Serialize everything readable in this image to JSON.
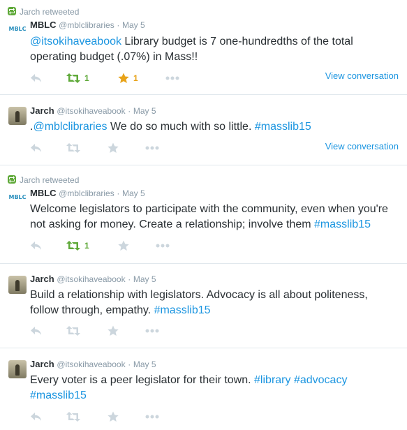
{
  "tweets": [
    {
      "retweeted_by": "Jarch retweeted",
      "name": "MBLC",
      "handle": "@mblclibraries",
      "dot": "·",
      "date": "May 5",
      "avatar_text": "MBLC",
      "body_parts": [
        {
          "text": "@itsokihaveabook",
          "link": true
        },
        {
          "text": " Library budget is 7 one-hundredths of the total operating budget (.07%) in Mass!!",
          "link": false
        }
      ],
      "retweet_count": "1",
      "favorite_count": "1",
      "view_conversation": "View conversation"
    },
    {
      "name": "Jarch",
      "handle": "@itsokihaveabook",
      "dot": "·",
      "date": "May 5",
      "body_parts": [
        {
          "text": ".",
          "link": false
        },
        {
          "text": "@mblclibraries",
          "link": true
        },
        {
          "text": " We do so much with so little. ",
          "link": false
        },
        {
          "text": "#masslib15",
          "link": true
        }
      ],
      "view_conversation": "View conversation"
    },
    {
      "retweeted_by": "Jarch retweeted",
      "name": "MBLC",
      "handle": "@mblclibraries",
      "dot": "·",
      "date": "May 5",
      "avatar_text": "MBLC",
      "body_parts": [
        {
          "text": "Welcome legislators to participate with the community, even when you're not asking for money. Create a relationship; involve them ",
          "link": false
        },
        {
          "text": "#masslib15",
          "link": true
        }
      ],
      "retweet_count": "1"
    },
    {
      "name": "Jarch",
      "handle": "@itsokihaveabook",
      "dot": "·",
      "date": "May 5",
      "body_parts": [
        {
          "text": "Build a relationship with legislators. Advocacy is all about politeness, follow through, empathy. ",
          "link": false
        },
        {
          "text": "#masslib15",
          "link": true
        }
      ]
    },
    {
      "name": "Jarch",
      "handle": "@itsokihaveabook",
      "dot": "·",
      "date": "May 5",
      "body_parts": [
        {
          "text": "Every voter is a peer legislator for their town. ",
          "link": false
        },
        {
          "text": "#library",
          "link": true
        },
        {
          "text": " ",
          "link": false
        },
        {
          "text": "#advocacy",
          "link": true
        },
        {
          "text": " ",
          "link": false
        },
        {
          "text": "#masslib15",
          "link": true
        }
      ]
    }
  ],
  "colors": {
    "link": "#1b95e0",
    "retweet_active": "#5fa939",
    "favorite_active": "#e8a319",
    "icon_inactive": "#ccd6dd",
    "meta": "#8899a6"
  },
  "icons": [
    "reply-icon",
    "retweet-icon",
    "favorite-icon",
    "more-icon"
  ]
}
